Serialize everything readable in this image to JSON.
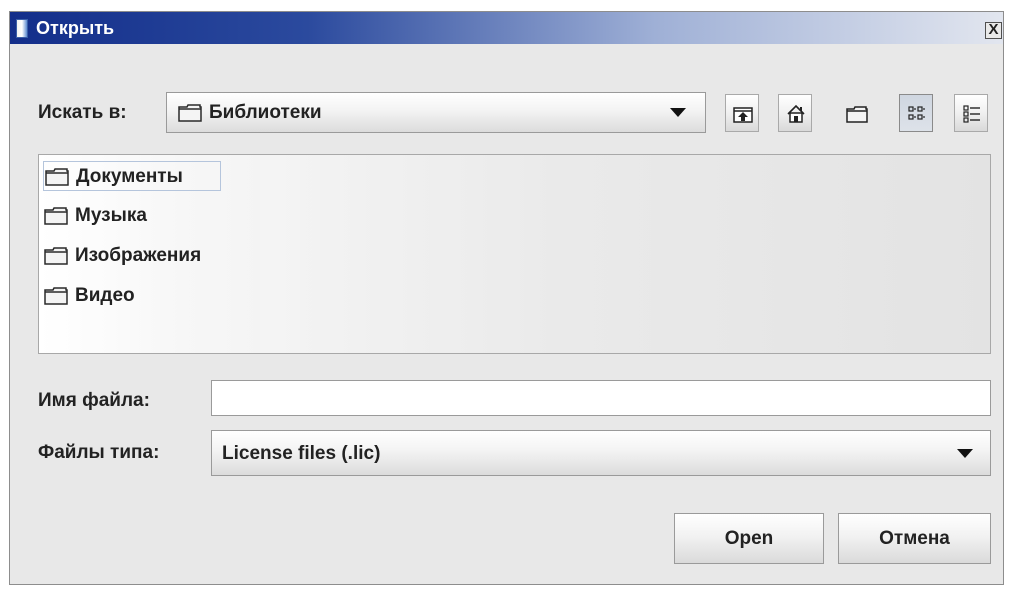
{
  "dialog": {
    "title": "Открыть",
    "close_label": "X"
  },
  "look_in": {
    "label": "Искать в:",
    "value": "Библиотеки",
    "icon": "folder-icon"
  },
  "toolbar": {
    "buttons": [
      {
        "name": "up-one-level-button",
        "icon": "folder-up-icon"
      },
      {
        "name": "home-button",
        "icon": "home-icon"
      },
      {
        "name": "new-folder-button",
        "icon": "new-folder-icon"
      },
      {
        "name": "list-view-button",
        "icon": "list-view-icon",
        "pressed": true
      },
      {
        "name": "details-view-button",
        "icon": "details-view-icon"
      }
    ]
  },
  "files": {
    "items": [
      {
        "label": "Документы",
        "icon": "folder-icon",
        "selected": true
      },
      {
        "label": "Музыка",
        "icon": "folder-icon"
      },
      {
        "label": "Изображения",
        "icon": "folder-icon"
      },
      {
        "label": "Видео",
        "icon": "folder-icon"
      }
    ]
  },
  "file_name": {
    "label": "Имя файла:",
    "value": ""
  },
  "file_type": {
    "label": "Файлы типа:",
    "value": "License files (.lic)"
  },
  "actions": {
    "open_label": "Open",
    "cancel_label": "Отмена"
  },
  "colors": {
    "titlebar_start": "#132e8a",
    "titlebar_end": "#e2e6ef",
    "window_bg": "#e8e8e8"
  }
}
